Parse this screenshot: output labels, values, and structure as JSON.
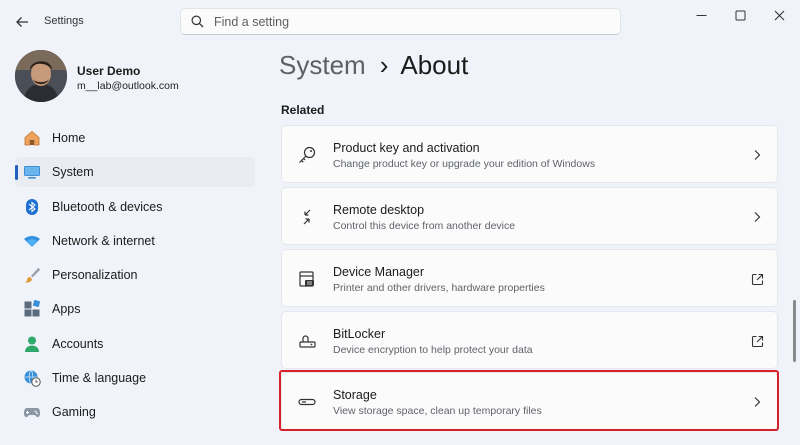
{
  "window": {
    "title": "Settings",
    "controls": {
      "minimize": "minimize",
      "maximize": "maximize",
      "close": "close"
    }
  },
  "search": {
    "placeholder": "Find a setting",
    "value": ""
  },
  "profile": {
    "name": "User Demo",
    "email": "m__lab@outlook.com"
  },
  "nav": {
    "items": [
      {
        "id": "home",
        "label": "Home",
        "icon": "home-icon",
        "active": false
      },
      {
        "id": "system",
        "label": "System",
        "icon": "monitor-icon",
        "active": true
      },
      {
        "id": "bluetooth",
        "label": "Bluetooth & devices",
        "icon": "bluetooth-icon",
        "active": false
      },
      {
        "id": "network",
        "label": "Network & internet",
        "icon": "wifi-icon",
        "active": false
      },
      {
        "id": "personalization",
        "label": "Personalization",
        "icon": "brush-icon",
        "active": false
      },
      {
        "id": "apps",
        "label": "Apps",
        "icon": "apps-icon",
        "active": false
      },
      {
        "id": "accounts",
        "label": "Accounts",
        "icon": "person-icon",
        "active": false
      },
      {
        "id": "time",
        "label": "Time & language",
        "icon": "globe-clock-icon",
        "active": false
      },
      {
        "id": "gaming",
        "label": "Gaming",
        "icon": "gamepad-icon",
        "active": false
      }
    ]
  },
  "page": {
    "breadcrumb_parent": "System",
    "breadcrumb_separator": "›",
    "breadcrumb_current": "About",
    "section_label": "Related"
  },
  "cards": [
    {
      "title": "Product key and activation",
      "description": "Change product key or upgrade your edition of Windows",
      "icon": "key-icon",
      "action": "chevron-right-icon"
    },
    {
      "title": "Remote desktop",
      "description": "Control this device from another device",
      "icon": "remote-desktop-icon",
      "action": "chevron-right-icon"
    },
    {
      "title": "Device Manager",
      "description": "Printer and other drivers, hardware properties",
      "icon": "device-manager-icon",
      "action": "external-link-icon"
    },
    {
      "title": "BitLocker",
      "description": "Device encryption to help protect your data",
      "icon": "bitlocker-icon",
      "action": "external-link-icon"
    },
    {
      "title": "Storage",
      "description": "View storage space, clean up temporary files",
      "icon": "storage-icon",
      "action": "chevron-right-icon",
      "highlighted": true
    }
  ],
  "colors": {
    "accent": "#1f5fbf",
    "highlight": "#d6212a",
    "background": "#f0f3f9"
  }
}
